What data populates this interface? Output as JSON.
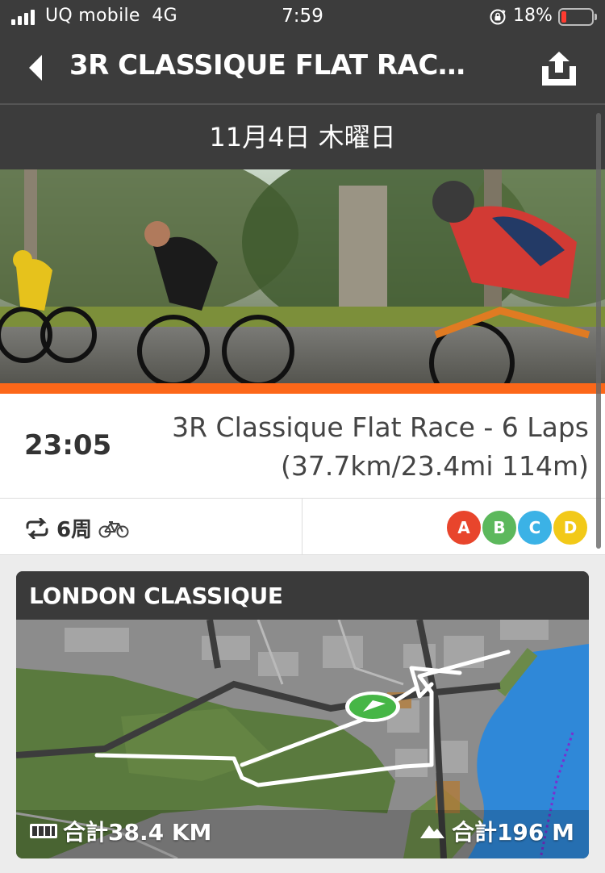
{
  "status_bar": {
    "carrier": "UQ mobile",
    "network": "4G",
    "time": "7:59",
    "battery_percent": "18%",
    "battery_level": 0.18
  },
  "header": {
    "title": "3R CLASSIQUE FLAT RAC…"
  },
  "date": "11月4日 木曜日",
  "event": {
    "start_time": "23:05",
    "name": "3R Classique Flat Race - 6 Laps (37.7km/23.4mi 114m)",
    "laps": "6周",
    "categories": [
      {
        "label": "A",
        "color": "#e8452c"
      },
      {
        "label": "B",
        "color": "#5cb85c"
      },
      {
        "label": "C",
        "color": "#3bb2e6"
      },
      {
        "label": "D",
        "color": "#f2c918"
      }
    ]
  },
  "map": {
    "title": "LONDON CLASSIQUE",
    "distance": "合計38.4 KM",
    "elevation": "合計196 M"
  },
  "colors": {
    "header_bg": "#3c3c3c",
    "accent": "#fc6719"
  }
}
